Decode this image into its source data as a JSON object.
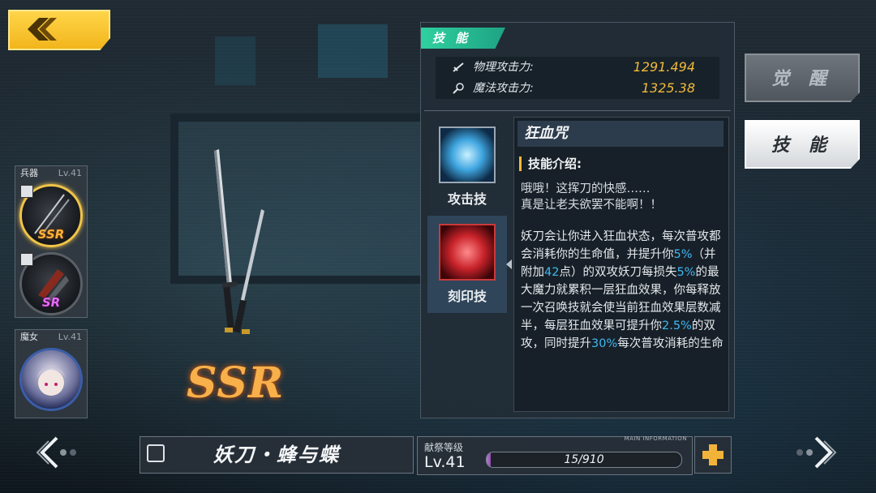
{
  "skill_panel": {
    "tab_label": "技 能",
    "stats": [
      {
        "icon": "sword-icon",
        "label": "物理攻击力:",
        "value": "1291.494"
      },
      {
        "icon": "magic-wand-icon",
        "label": "魔法攻击力:",
        "value": "1325.38"
      }
    ],
    "skills": [
      {
        "label": "攻击技",
        "icon": "blade-slash-icon"
      },
      {
        "label": "刻印技",
        "icon": "blood-sword-icon"
      }
    ],
    "detail": {
      "name": "狂血咒",
      "heading": "技能介绍:",
      "flavor_line1": "哦哦！这挥刀的快感……",
      "flavor_line2": "真是让老夫欲罢不能啊！！",
      "desc_part1": "妖刀会让你进入狂血状态，每次普攻都会消耗你的生命值，并提升你",
      "hl1": "5%",
      "desc_part2": "（并附加",
      "hl2": "42",
      "desc_part3": "点）的双攻妖刀每损失",
      "hl3": "5%",
      "desc_part4": "的最大魔力就累积一层狂血效果，你每释放一次召唤技就会使当前狂血效果层数减半，每层狂血效果可提升你",
      "hl4": "2.5%",
      "desc_part5": "的双攻，同时提升",
      "hl5": "30%",
      "desc_part6": "每次普攻消耗的生命"
    }
  },
  "side_buttons": {
    "awaken": "觉 醒",
    "skill": "技 能"
  },
  "slots": {
    "weapon": {
      "header": "兵器",
      "level": "Lv.41",
      "items": [
        {
          "rank": "SSR"
        },
        {
          "rank": "SR"
        }
      ]
    },
    "witch": {
      "header": "魔女",
      "level": "Lv.41"
    }
  },
  "weapon_rank": "SSR",
  "bottom": {
    "weapon_name": "妖刀・蜂与蝶",
    "level_label": "献祭等级",
    "level": "Lv.41",
    "main_info": "MAIN INFORMATION",
    "xp_text": "15/910",
    "xp_fraction": 0.016
  },
  "colors": {
    "accent_gold": "#f2b93a",
    "highlight_blue": "#3fb8f2",
    "tab_green": "#2fd0a0"
  }
}
